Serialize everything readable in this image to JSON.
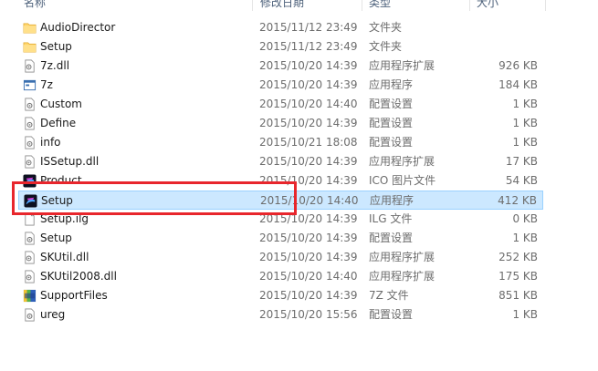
{
  "header": {
    "name_label": "名称",
    "date_label": "修改日期",
    "type_label": "类型",
    "size_label": "大小"
  },
  "files": [
    {
      "name": "AudioDirector",
      "date": "2015/11/12 23:49",
      "type": "文件夹",
      "size": "",
      "icon": "folder-icon"
    },
    {
      "name": "Setup",
      "date": "2015/11/12 23:49",
      "type": "文件夹",
      "size": "",
      "icon": "folder-icon"
    },
    {
      "name": "7z.dll",
      "date": "2015/10/20 14:39",
      "type": "应用程序扩展",
      "size": "926 KB",
      "icon": "dll-icon"
    },
    {
      "name": "7z",
      "date": "2015/10/20 14:39",
      "type": "应用程序",
      "size": "184 KB",
      "icon": "exe-icon"
    },
    {
      "name": "Custom",
      "date": "2015/10/20 14:40",
      "type": "配置设置",
      "size": "1 KB",
      "icon": "config-icon"
    },
    {
      "name": "Define",
      "date": "2015/10/20 14:39",
      "type": "配置设置",
      "size": "1 KB",
      "icon": "config-icon"
    },
    {
      "name": "info",
      "date": "2015/10/21 18:08",
      "type": "配置设置",
      "size": "1 KB",
      "icon": "config-icon"
    },
    {
      "name": "ISSetup.dll",
      "date": "2015/10/20 14:39",
      "type": "应用程序扩展",
      "size": "17 KB",
      "icon": "dll-icon"
    },
    {
      "name": "Product",
      "date": "2015/10/20 14:39",
      "type": "ICO 图片文件",
      "size": "54 KB",
      "icon": "app-icon"
    },
    {
      "name": "Setup",
      "date": "2015/10/20 14:40",
      "type": "应用程序",
      "size": "412 KB",
      "icon": "app-icon",
      "selected": true
    },
    {
      "name": "Setup.ilg",
      "date": "2015/10/20 14:39",
      "type": "ILG 文件",
      "size": "0 KB",
      "icon": "file-icon"
    },
    {
      "name": "Setup",
      "date": "2015/10/20 14:39",
      "type": "配置设置",
      "size": "1 KB",
      "icon": "config-icon"
    },
    {
      "name": "SKUtil.dll",
      "date": "2015/10/20 14:39",
      "type": "应用程序扩展",
      "size": "252 KB",
      "icon": "dll-icon"
    },
    {
      "name": "SKUtil2008.dll",
      "date": "2015/10/20 14:40",
      "type": "应用程序扩展",
      "size": "175 KB",
      "icon": "dll-icon"
    },
    {
      "name": "SupportFiles",
      "date": "2015/10/20 14:39",
      "type": "7Z 文件",
      "size": "851 KB",
      "icon": "archive-icon"
    },
    {
      "name": "ureg",
      "date": "2015/10/20 15:56",
      "type": "配置设置",
      "size": "1 KB",
      "icon": "config-icon"
    }
  ],
  "colors": {
    "selection_bg": "#cce8ff",
    "selection_border": "#99d1ff",
    "highlight": "#e8262c"
  }
}
